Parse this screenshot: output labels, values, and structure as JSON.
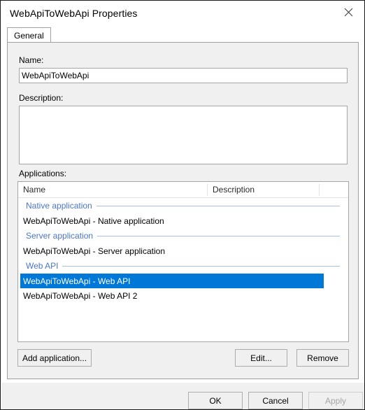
{
  "window": {
    "title": "WebApiToWebApi Properties",
    "close_icon": "close-icon"
  },
  "tabs": [
    {
      "label": "General",
      "selected": true
    }
  ],
  "form": {
    "name_label": "Name:",
    "name_value": "WebApiToWebApi",
    "description_label": "Description:",
    "description_value": "",
    "applications_label": "Applications:"
  },
  "list": {
    "columns": [
      {
        "label": "Name"
      },
      {
        "label": "Description"
      }
    ],
    "groups": [
      {
        "header": "Native application",
        "rows": [
          {
            "name": "WebApiToWebApi - Native application",
            "description": "",
            "selected": false
          }
        ]
      },
      {
        "header": "Server application",
        "rows": [
          {
            "name": "WebApiToWebApi - Server application",
            "description": "",
            "selected": false
          }
        ]
      },
      {
        "header": "Web API",
        "rows": [
          {
            "name": "WebApiToWebApi - Web API",
            "description": "",
            "selected": true
          },
          {
            "name": "WebApiToWebApi - Web API 2",
            "description": "",
            "selected": false
          }
        ]
      }
    ]
  },
  "list_buttons": {
    "add": "Add application...",
    "edit": "Edit...",
    "remove": "Remove"
  },
  "footer_buttons": {
    "ok": "OK",
    "cancel": "Cancel",
    "apply": "Apply",
    "apply_enabled": false
  },
  "colors": {
    "selection": "#0078d7",
    "group_header_text": "#4a76c8",
    "group_header_line": "#a9c0e6",
    "dialog_face": "#f0f0f0",
    "disabled_text": "#a6a6a6"
  }
}
